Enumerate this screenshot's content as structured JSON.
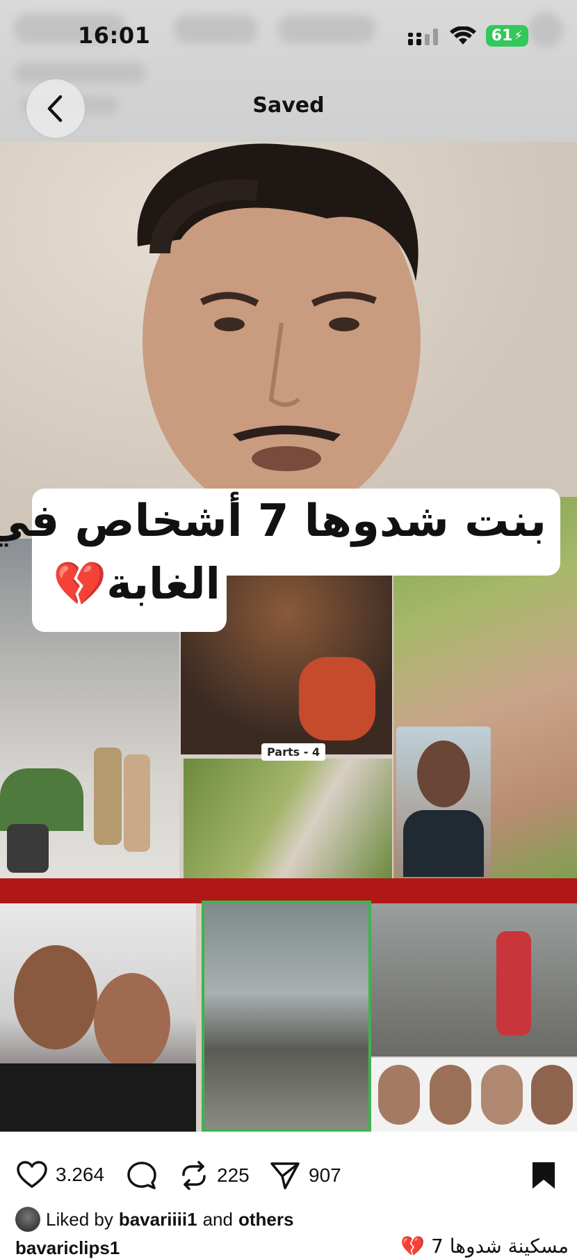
{
  "status_bar": {
    "time": "16:01",
    "battery": "61"
  },
  "header": {
    "title": "Saved"
  },
  "post": {
    "caption_line1": "بنت شدوها 7 أشخاص في",
    "caption_line2": "الغابة💔",
    "parts_label": "Parts - 4"
  },
  "actions": {
    "likes": "3.264",
    "reposts": "225",
    "shares": "907"
  },
  "liked_by": {
    "prefix": "Liked by",
    "user": "bavariiii1",
    "middle": "and",
    "others": "others"
  },
  "author": "bavariclips1",
  "caption_preview": "مسكينة شدوها 7 💔"
}
